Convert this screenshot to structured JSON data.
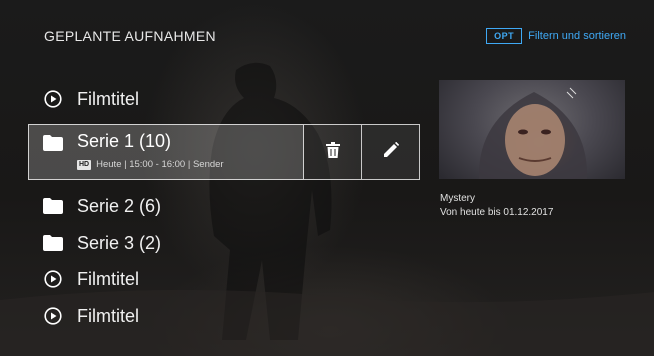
{
  "header": {
    "title": "GEPLANTE AUFNAHMEN"
  },
  "options": {
    "key": "OPT",
    "label": "Filtern und sortieren",
    "accent_color": "#3fa9f5"
  },
  "list": {
    "items": [
      {
        "icon": "play-icon",
        "label": "Filmtitel"
      },
      {
        "icon": "folder-icon",
        "label": "Serie 1 (10)",
        "selected": true,
        "meta": {
          "badge": "HD",
          "text": "Heute | 15:00 - 16:00 | Sender"
        },
        "actions": [
          {
            "icon": "trash-icon"
          },
          {
            "icon": "pencil-icon"
          }
        ]
      },
      {
        "icon": "folder-icon",
        "label": "Serie 2 (6)"
      },
      {
        "icon": "folder-icon",
        "label": "Serie 3 (2)"
      },
      {
        "icon": "play-icon",
        "label": "Filmtitel"
      },
      {
        "icon": "play-icon",
        "label": "Filmtitel"
      }
    ]
  },
  "detail": {
    "genre": "Mystery",
    "availability": "Von heute bis 01.12.2017"
  }
}
